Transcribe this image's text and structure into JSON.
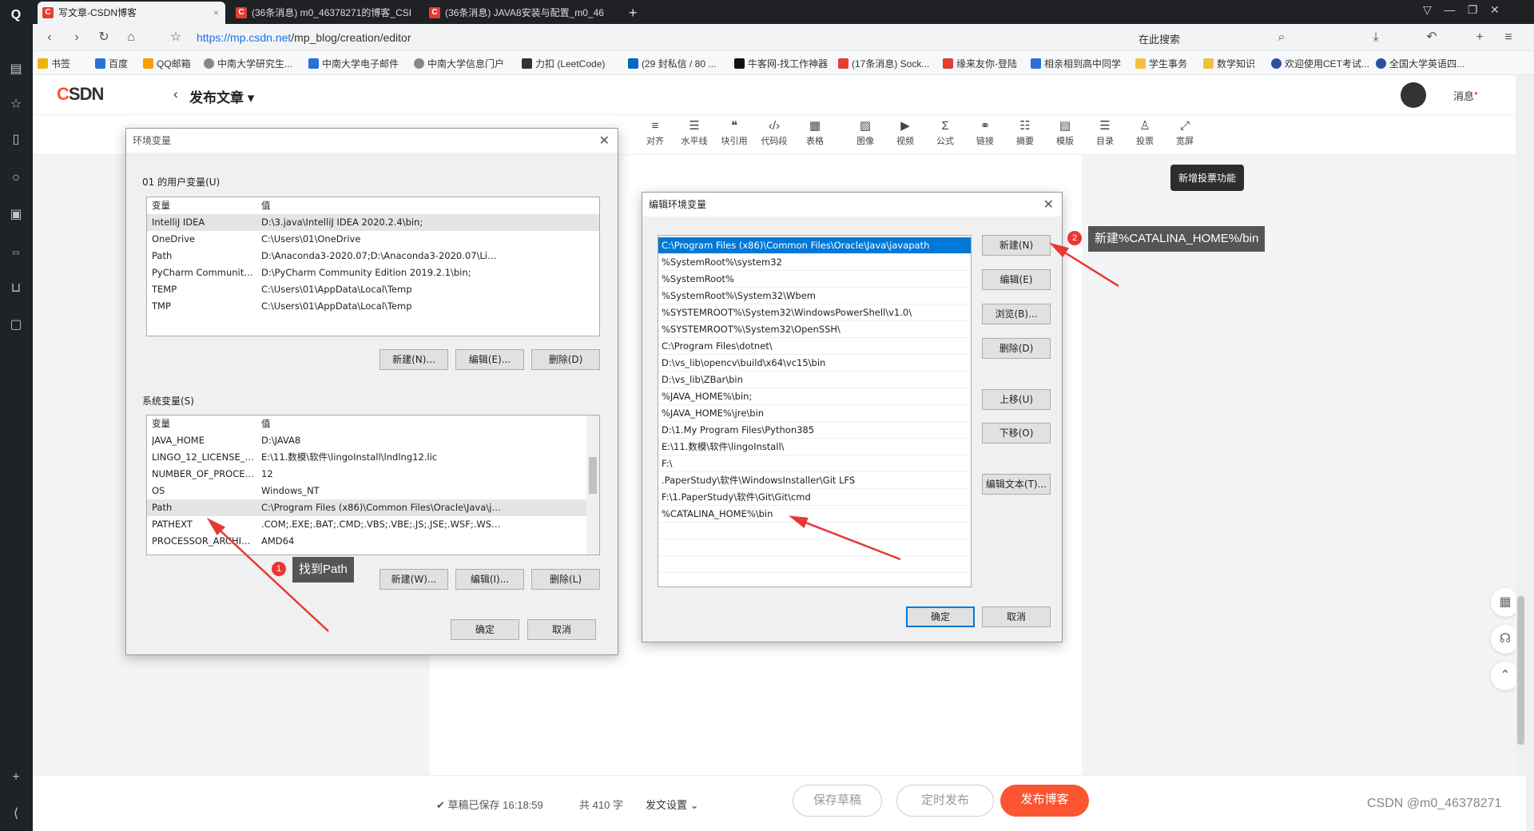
{
  "browser": {
    "tabs": [
      {
        "label": "写文章-CSDN博客",
        "active": true
      },
      {
        "label": "(36条消息) m0_46378271的博客_CSI",
        "active": false
      },
      {
        "label": "(36条消息) JAVA8安装与配置_m0_46",
        "active": false
      }
    ],
    "new_tab": "+",
    "url_host": "https://mp.csdn.net",
    "url_path": "/mp_blog/creation/editor",
    "search_placeholder": "在此搜索",
    "bookmarks": [
      "书签",
      "百度",
      "QQ邮箱",
      "中南大学研究生...",
      "中南大学电子邮件",
      "中南大学信息门户",
      "力扣 (LeetCode)",
      "(29 封私信 / 80 ...",
      "牛客网-找工作神器",
      "(17条消息) Sock...",
      "缘来友你-登陆",
      "相亲相到高中同学",
      "学生事务",
      "数学知识",
      "欢迎使用CET考试...",
      "全国大学英语四..."
    ]
  },
  "csdn": {
    "logo_c": "C",
    "logo_rest": "SDN",
    "page_title": "发布文章",
    "messages": "消息",
    "toolbar": [
      "对齐",
      "水平线",
      "块引用",
      "代码段",
      "表格",
      "图像",
      "视频",
      "公式",
      "链接",
      "摘要",
      "模版",
      "目录",
      "投票",
      "宽屏"
    ],
    "tooltip": "新增投票功能",
    "autosave": "草稿已保存 16:18:59",
    "word_count": "共 410 字",
    "publish_settings": "发文设置",
    "save_draft": "保存草稿",
    "schedule": "定时发布",
    "publish": "发布博客",
    "watermark": "CSDN @m0_46378271"
  },
  "env_dialog": {
    "title": "环境变量",
    "user_group": "01 的用户变量(U)",
    "col_var": "变量",
    "col_val": "值",
    "user_vars": [
      {
        "name": "IntelliJ IDEA",
        "value": "D:\\3.java\\IntelliJ IDEA 2020.2.4\\bin;"
      },
      {
        "name": "OneDrive",
        "value": "C:\\Users\\01\\OneDrive"
      },
      {
        "name": "Path",
        "value": "D:\\Anaconda3-2020.07;D:\\Anaconda3-2020.07\\Library\\mingw..."
      },
      {
        "name": "PyCharm Community Editi...",
        "value": "D:\\PyCharm Community Edition 2019.2.1\\bin;"
      },
      {
        "name": "TEMP",
        "value": "C:\\Users\\01\\AppData\\Local\\Temp"
      },
      {
        "name": "TMP",
        "value": "C:\\Users\\01\\AppData\\Local\\Temp"
      }
    ],
    "user_buttons": [
      "新建(N)...",
      "编辑(E)...",
      "删除(D)"
    ],
    "sys_group": "系统变量(S)",
    "sys_vars": [
      {
        "name": "JAVA_HOME",
        "value": "D:\\JAVA8"
      },
      {
        "name": "LINGO_12_LICENSE_FILE",
        "value": "E:\\11.数模\\软件\\lingoInstall\\lndlng12.lic"
      },
      {
        "name": "NUMBER_OF_PROCESSORS",
        "value": "12"
      },
      {
        "name": "OS",
        "value": "Windows_NT"
      },
      {
        "name": "Path",
        "value": "C:\\Program Files (x86)\\Common Files\\Oracle\\Java\\javapath;C:..."
      },
      {
        "name": "PATHEXT",
        "value": ".COM;.EXE;.BAT;.CMD;.VBS;.VBE;.JS;.JSE;.WSF;.WSH;.MSC;.PY;.P..."
      },
      {
        "name": "PROCESSOR_ARCHITECT...",
        "value": "AMD64"
      }
    ],
    "sys_buttons": [
      "新建(W)...",
      "编辑(I)...",
      "删除(L)"
    ],
    "ok": "确定",
    "cancel": "取消"
  },
  "edit_dialog": {
    "title": "编辑环境变量",
    "entries": [
      "C:\\Program Files (x86)\\Common Files\\Oracle\\Java\\javapath",
      "%SystemRoot%\\system32",
      "%SystemRoot%",
      "%SystemRoot%\\System32\\Wbem",
      "%SYSTEMROOT%\\System32\\WindowsPowerShell\\v1.0\\",
      "%SYSTEMROOT%\\System32\\OpenSSH\\",
      "C:\\Program Files\\dotnet\\",
      "D:\\vs_lib\\opencv\\build\\x64\\vc15\\bin",
      "D:\\vs_lib\\ZBar\\bin",
      "%JAVA_HOME%\\bin;",
      "%JAVA_HOME%\\jre\\bin",
      "D:\\1.My Program Files\\Python385",
      "E:\\11.数模\\软件\\lingoInstall\\",
      "F:\\",
      ".PaperStudy\\软件\\WindowsInstaller\\Git LFS",
      "F:\\1.PaperStudy\\软件\\Git\\Git\\cmd",
      "%CATALINA_HOME%\\bin"
    ],
    "buttons": [
      "新建(N)",
      "编辑(E)",
      "浏览(B)...",
      "删除(D)",
      "上移(U)",
      "下移(O)",
      "编辑文本(T)..."
    ],
    "ok": "确定",
    "cancel": "取消"
  },
  "annotations": {
    "n1": "1",
    "callout1": "找到Path",
    "n2": "2",
    "callout2": "新建%CATALINA_HOME%/bin"
  },
  "colors": {
    "accent": "#fc5531",
    "select": "#0078d7",
    "arrow": "#e53935"
  }
}
